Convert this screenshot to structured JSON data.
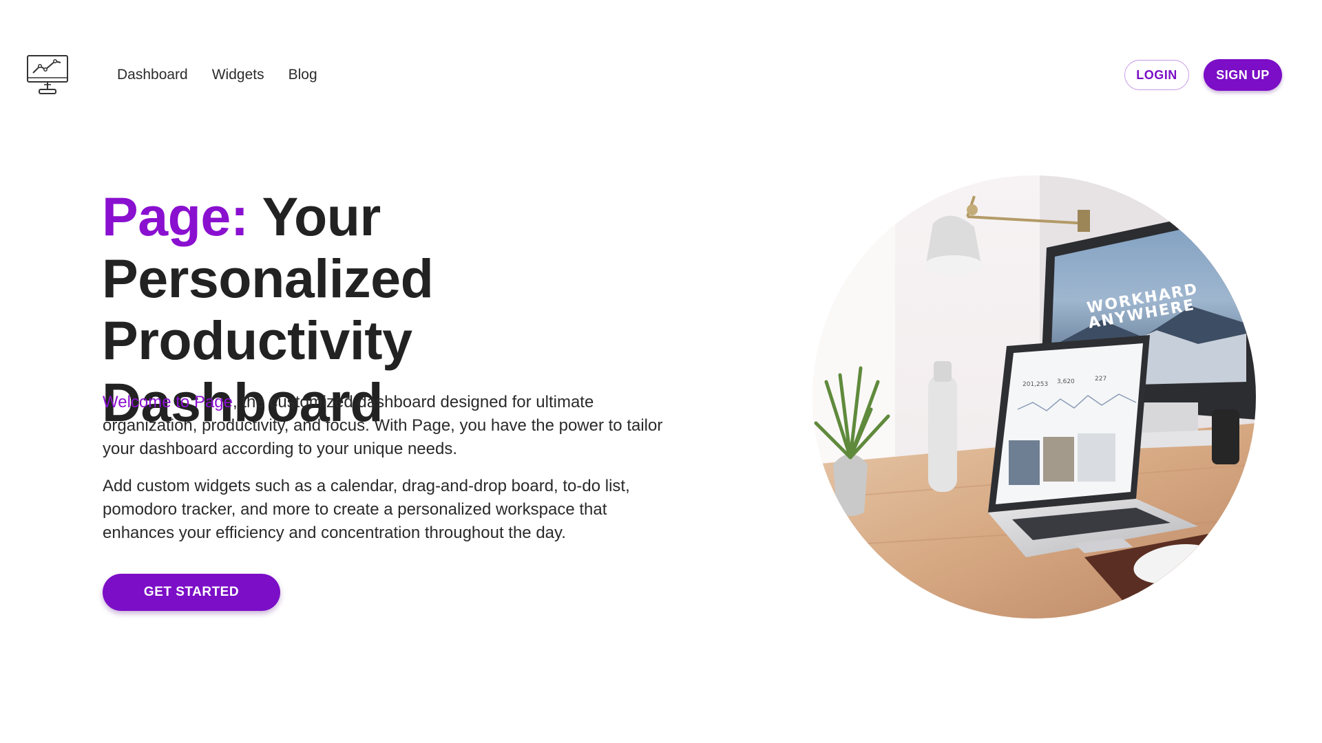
{
  "nav": {
    "items": [
      {
        "label": "Dashboard"
      },
      {
        "label": "Widgets"
      },
      {
        "label": "Blog"
      }
    ],
    "login_label": "LOGIN",
    "signup_label": "SIGN UP"
  },
  "hero": {
    "title_brand": "Page:",
    "title_rest": " Your Personalized Productivity Dashboard",
    "intro_accent": "Welcome to Page",
    "intro_rest": ", the customized dashboard designed for ultimate organization, productivity, and focus. With Page, you have the power to tailor your dashboard according to your unique needs.",
    "description": "Add custom widgets such as a calendar, drag-and-drop board, to-do list, pomodoro tracker, and more to create a personalized workspace that enhances your efficiency and concentration throughout the day.",
    "cta_label": "GET STARTED"
  },
  "image": {
    "monitor_text_line1": "WORKHARD",
    "monitor_text_line2": "ANYWHERE",
    "laptop_stats": [
      "201,253",
      "3,620",
      "227"
    ]
  },
  "colors": {
    "accent": "#8a10d0",
    "button": "#7b0ec6",
    "text": "#222222"
  },
  "icons": {
    "logo": "monitor-chart-icon"
  }
}
